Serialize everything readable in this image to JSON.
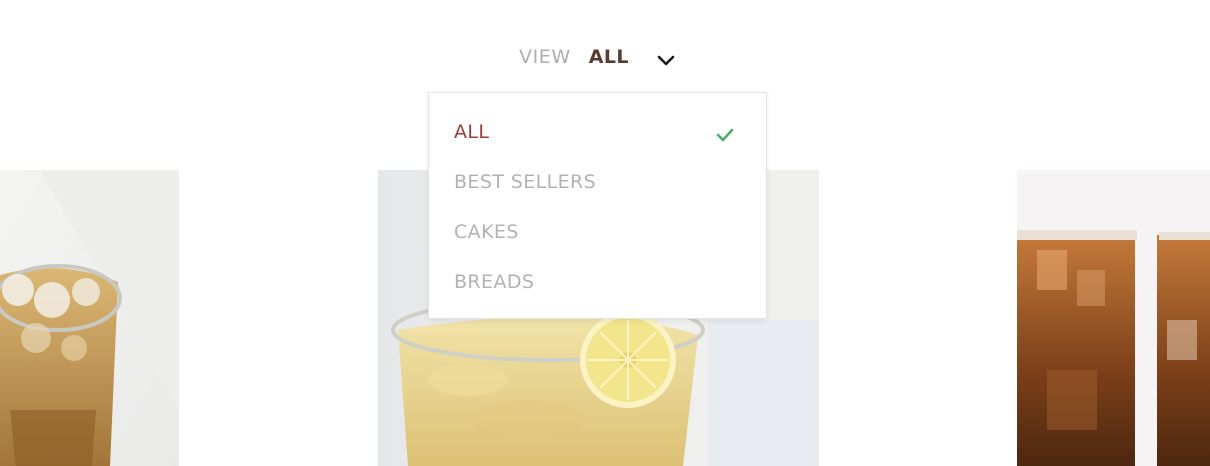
{
  "filter": {
    "view_label": "VIEW",
    "current_value": "ALL",
    "toggle_icon": "chevron-down-icon"
  },
  "dropdown": {
    "selected_index": 0,
    "items": [
      {
        "label": "ALL",
        "selected": true,
        "icon": "check-icon"
      },
      {
        "label": "BEST SELLERS",
        "selected": false
      },
      {
        "label": "CAKES",
        "selected": false
      },
      {
        "label": "BREADS",
        "selected": false
      }
    ]
  },
  "products": [
    {
      "image": "iced-tea-glass"
    },
    {
      "image": "lemonade-glass-with-lemon-slice"
    },
    {
      "image": "iced-coffee-glasses"
    }
  ],
  "colors": {
    "selected_text": "#9b3d38",
    "unselected_text": "#b2b2b2",
    "view_label": "#aeaeae",
    "current_value": "#5a3c32",
    "check": "#4caf6a"
  }
}
